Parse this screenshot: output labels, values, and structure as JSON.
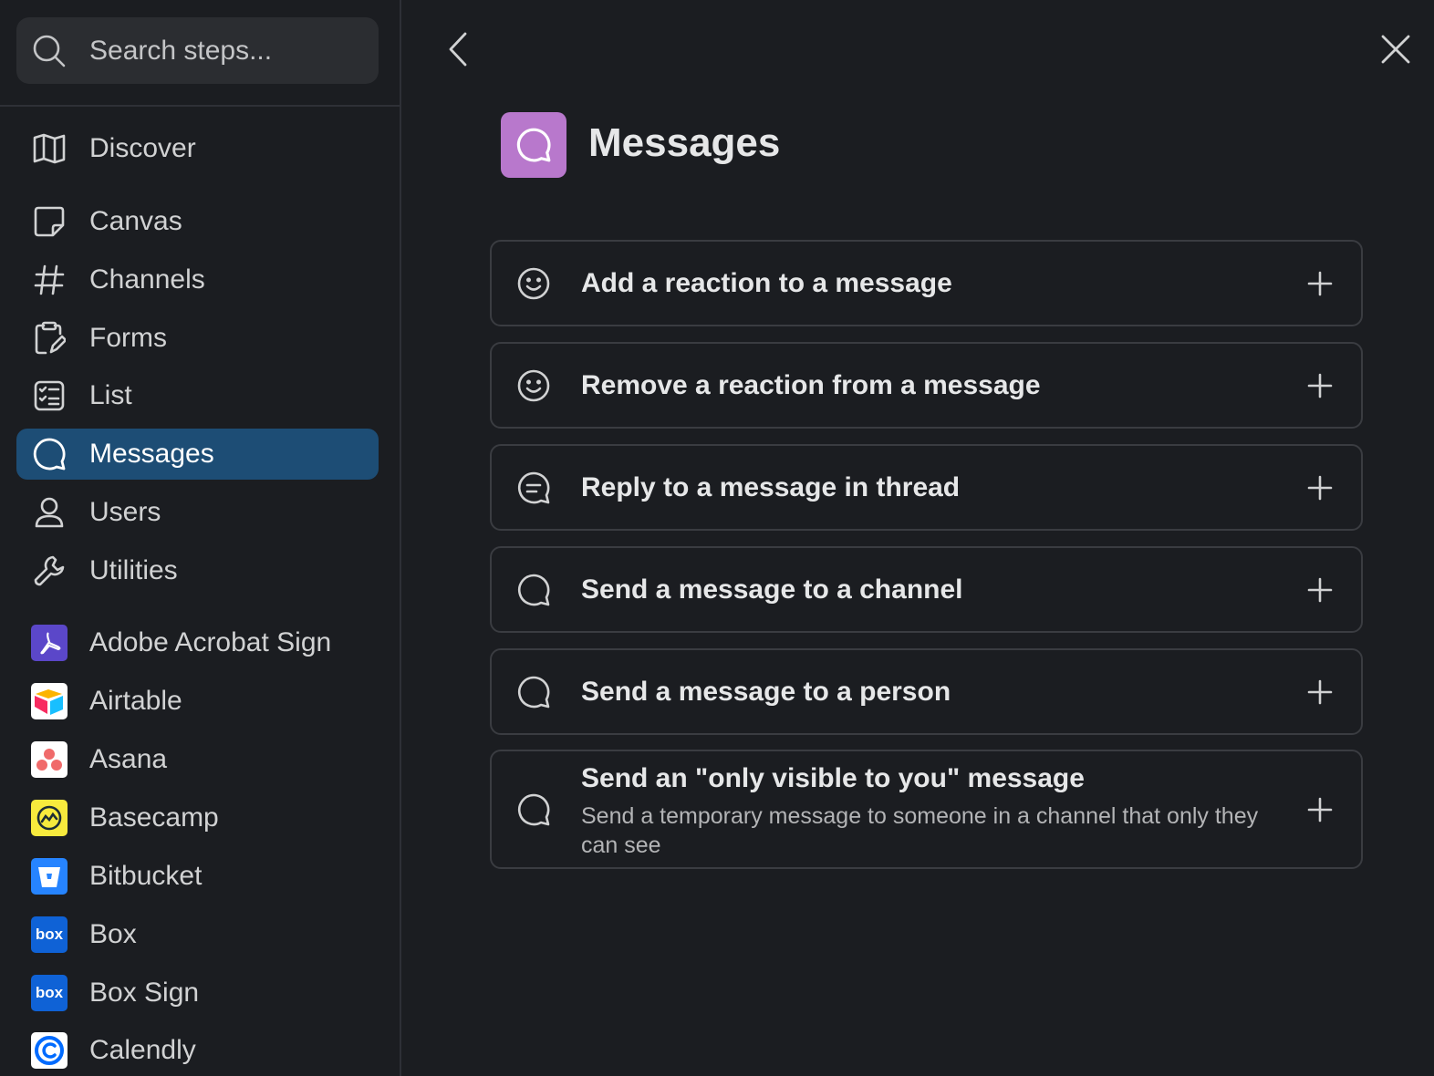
{
  "search": {
    "placeholder": "Search steps..."
  },
  "sidebar": {
    "builtins": [
      {
        "label": "Discover",
        "icon": "map-icon"
      },
      {
        "label": "Canvas",
        "icon": "canvas-icon"
      },
      {
        "label": "Channels",
        "icon": "hash-icon"
      },
      {
        "label": "Forms",
        "icon": "form-icon"
      },
      {
        "label": "List",
        "icon": "list-icon"
      },
      {
        "label": "Messages",
        "icon": "message-bubble-icon",
        "active": true
      },
      {
        "label": "Users",
        "icon": "user-icon"
      },
      {
        "label": "Utilities",
        "icon": "wrench-icon"
      }
    ],
    "apps": [
      {
        "label": "Adobe Acrobat Sign",
        "icon": "adobe-acrobat-sign-logo-icon"
      },
      {
        "label": "Airtable",
        "icon": "airtable-logo-icon"
      },
      {
        "label": "Asana",
        "icon": "asana-logo-icon"
      },
      {
        "label": "Basecamp",
        "icon": "basecamp-logo-icon"
      },
      {
        "label": "Bitbucket",
        "icon": "bitbucket-logo-icon"
      },
      {
        "label": "Box",
        "icon": "box-logo-icon",
        "logo_text": "box"
      },
      {
        "label": "Box Sign",
        "icon": "box-sign-logo-icon",
        "logo_text": "box"
      },
      {
        "label": "Calendly",
        "icon": "calendly-logo-icon"
      }
    ]
  },
  "main": {
    "title": "Messages",
    "steps": [
      {
        "title": "Add a reaction to a message",
        "icon": "smiley-icon"
      },
      {
        "title": "Remove a reaction from a message",
        "icon": "smiley-icon"
      },
      {
        "title": "Reply to a message in thread",
        "icon": "thread-bubble-icon"
      },
      {
        "title": "Send a message to a channel",
        "icon": "message-bubble-icon"
      },
      {
        "title": "Send a message to a person",
        "icon": "message-bubble-icon"
      },
      {
        "title": "Send an \"only visible to you\" message",
        "description": "Send a temporary message to someone in a channel that only they can see",
        "icon": "message-bubble-icon"
      }
    ]
  },
  "colors": {
    "background": "#1b1d21",
    "active_nav": "#1d4d75",
    "header_icon": "#b878cc",
    "card_border": "#3a3c41"
  }
}
